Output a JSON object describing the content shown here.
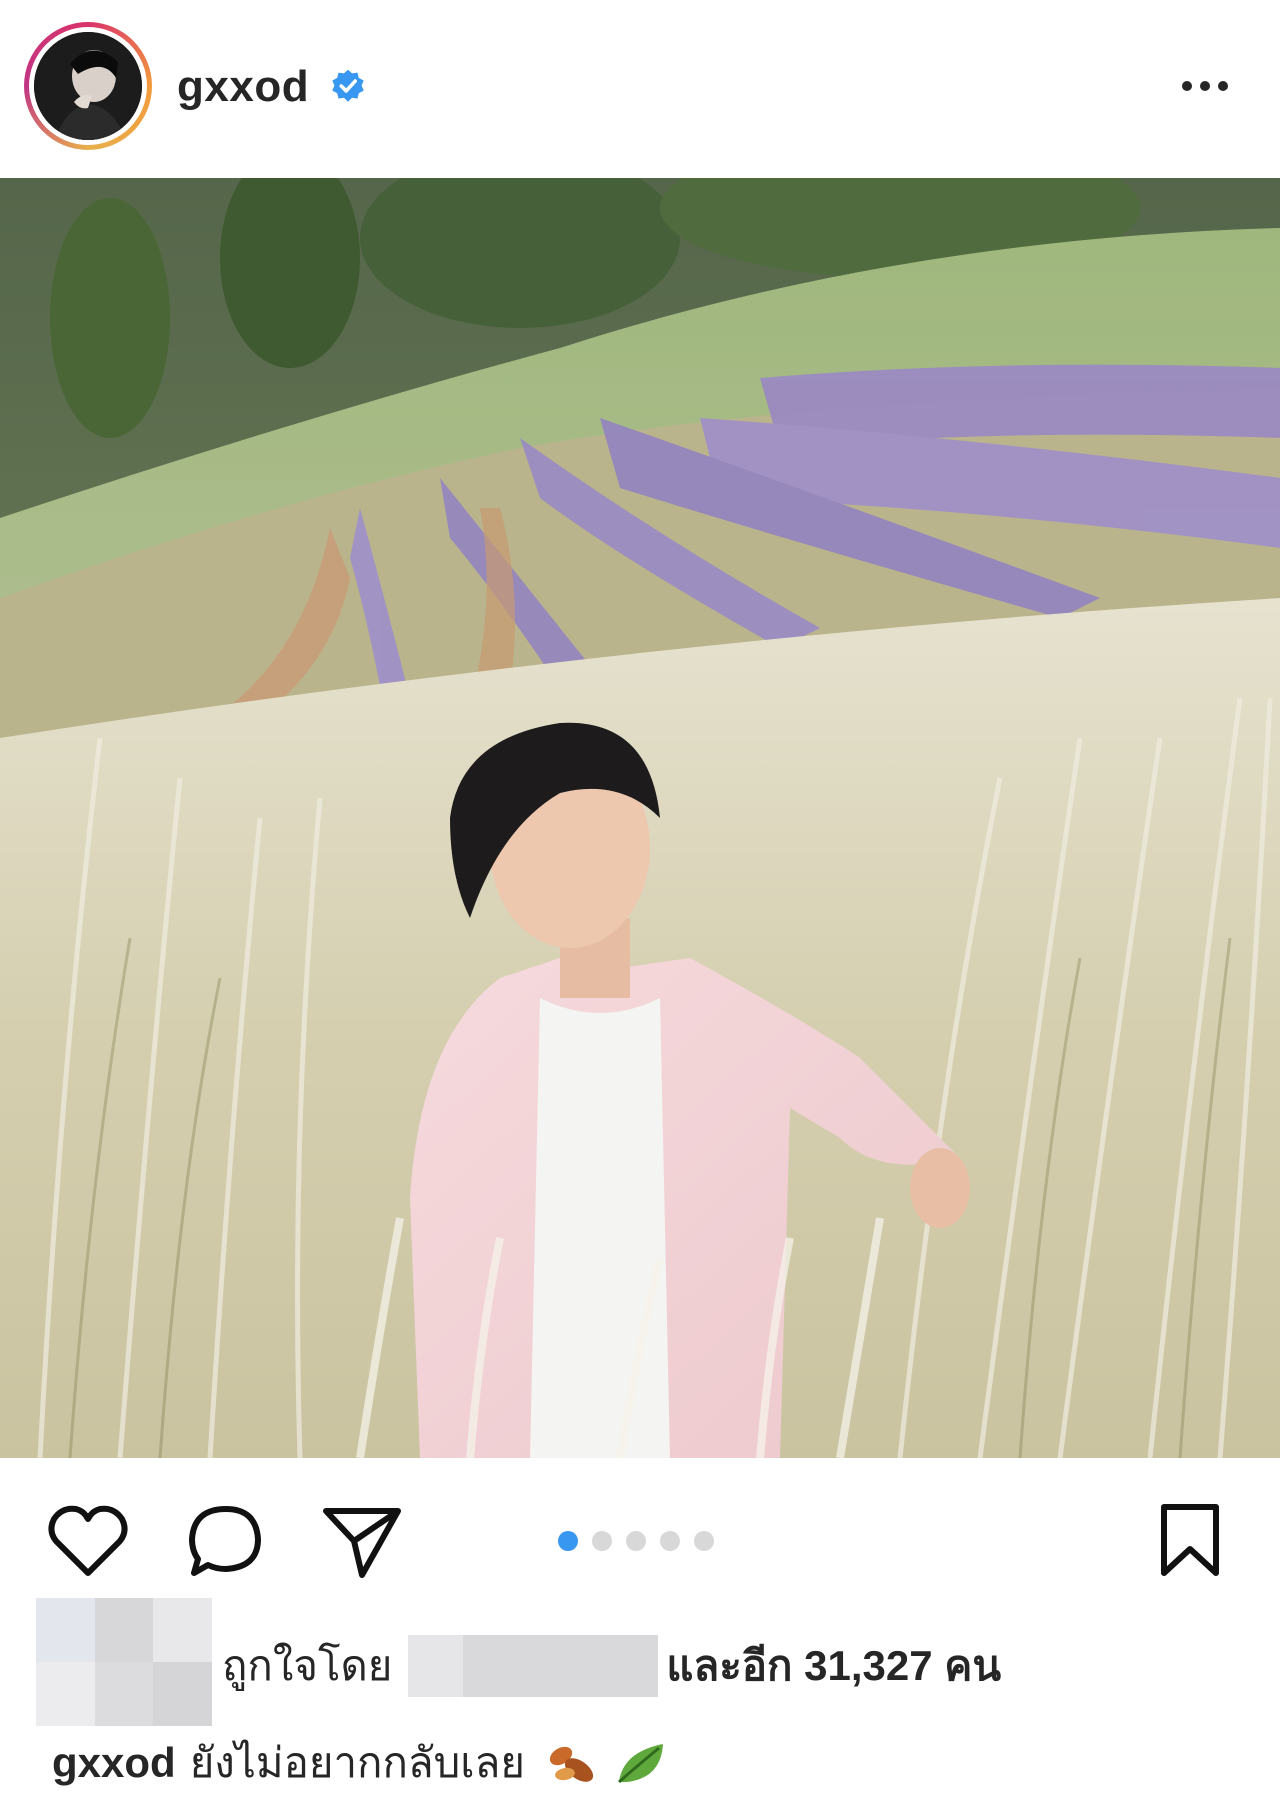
{
  "post": {
    "username": "gxxod",
    "verified": true,
    "carousel": {
      "count": 5,
      "active_index": 0
    }
  },
  "likes": {
    "prefix": "ถูกใจโดย",
    "suffix": "และอีก 31,327 คน"
  },
  "caption": {
    "username": "gxxod",
    "text": "ยังไม่อยากกลับเลย",
    "emoji": [
      "fallen-leaves-icon",
      "leaf-icon"
    ]
  },
  "colors": {
    "accent_blue": "#3897f0",
    "text": "#262626",
    "dot_inactive": "#d8d8d8"
  },
  "icons": [
    "like-icon",
    "comment-icon",
    "share-icon",
    "save-icon",
    "more-icon",
    "verified-icon"
  ]
}
